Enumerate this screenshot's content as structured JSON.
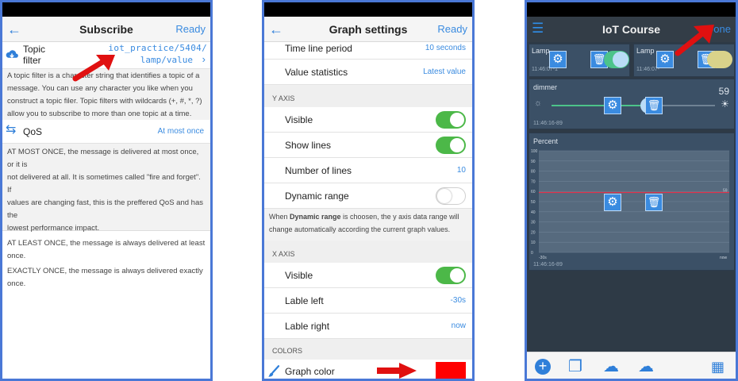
{
  "subscribe": {
    "title": "Subscribe",
    "action": "Ready",
    "topic_label_1": "Topic",
    "topic_label_2": "filter",
    "topic_value_1": "iot_practice/5404/",
    "topic_value_2": "lamp/value",
    "topic_help": [
      "A topic filter is a character string that identifies a topic of a",
      "message. You can use any character you like when you",
      "construct a topic filer. Topic filters with wildcards (+, #, *, ?)",
      "allow you to subscribe to more than one topic at a time."
    ],
    "qos_label": "QoS",
    "qos_value": "At most once",
    "qos_help": [
      "AT MOST ONCE, the message is delivered at most once, or it is",
      "not delivered at all. It is sometimes called \"fire and forget\". If",
      "values are changing fast, this is the preffered QoS and has the",
      "lowest performance impact."
    ],
    "qos_least": "AT LEAST ONCE, the message is always delivered at least once.",
    "qos_exactly": "EXACTLY ONCE, the message is always delivered exactly once."
  },
  "graph": {
    "title": "Graph settings",
    "action": "Ready",
    "time_line_label": "Time line period",
    "time_line_value": "10 seconds",
    "value_stats_label": "Value statistics",
    "value_stats_value": "Latest value",
    "y_axis_head": "Y AXIS",
    "y_visible_label": "Visible",
    "y_visible_on": true,
    "y_lines_label": "Show lines",
    "y_lines_on": true,
    "num_lines_label": "Number of lines",
    "num_lines_value": "10",
    "dyn_range_label": "Dynamic range",
    "dyn_range_on": false,
    "dyn_help_pre": "When ",
    "dyn_help_bold": "Dynamic range",
    "dyn_help_post": " is choosen, the y axis data range will",
    "dyn_help_line2": "change automatically according the current graph values.",
    "x_axis_head": "X AXIS",
    "x_visible_label": "Visible",
    "x_visible_on": true,
    "label_left_label": "Lable left",
    "label_left_value": "-30s",
    "label_right_label": "Lable right",
    "label_right_value": "now",
    "colors_head": "COLORS",
    "graph_color_label": "Graph color",
    "graph_color": "#ff0000"
  },
  "iot": {
    "title": "IoT Course",
    "action": "Done",
    "tile1_label": "Lamp",
    "tile1_time": "11:46:07-1",
    "tile2_label": "Lamp",
    "tile2_time": "11:46:07-",
    "dimmer_label": "dimmer",
    "dimmer_value": "59",
    "dimmer_level": 0.59,
    "dimmer_time": "11:46:16-89",
    "percent_label": "Percent",
    "percent_time": "11:46:16-89",
    "percent_value": 59,
    "y_ticks": [
      "100",
      "90",
      "80",
      "70",
      "60",
      "50",
      "40",
      "30",
      "20",
      "10",
      "0"
    ],
    "right_tick": "59",
    "x_left": "-30s",
    "x_right": "now"
  },
  "colors": {
    "accent": "#3a8be0",
    "toggle_on": "#4cb848",
    "iot_bg": "#2e3a46",
    "graph_line": "#e0304a"
  }
}
